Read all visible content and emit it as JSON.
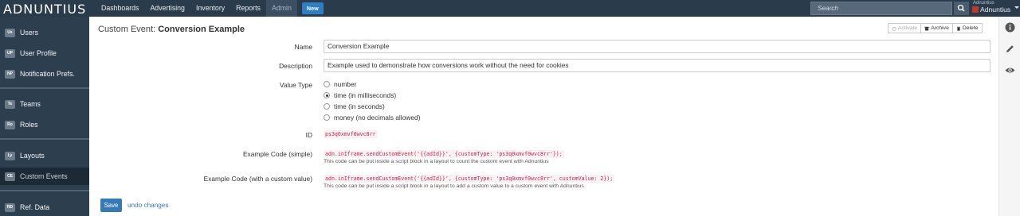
{
  "app": {
    "logo": "ADNUNTIUS"
  },
  "nav": {
    "items": [
      "Dashboards",
      "Advertising",
      "Inventory",
      "Reports",
      "Admin"
    ],
    "new_label": "New"
  },
  "search": {
    "placeholder": "Search"
  },
  "user": {
    "top": "Adnuntius",
    "name": "Adnuntius"
  },
  "sidebar": {
    "items": [
      {
        "badge": "Us",
        "label": "Users"
      },
      {
        "badge": "UP",
        "label": "User Profile"
      },
      {
        "badge": "NP",
        "label": "Notification Prefs."
      },
      {
        "badge": "Te",
        "label": "Teams"
      },
      {
        "badge": "Ro",
        "label": "Roles"
      },
      {
        "badge": "Ly",
        "label": "Layouts"
      },
      {
        "badge": "CE",
        "label": "Custom Events"
      },
      {
        "badge": "RD",
        "label": "Ref. Data"
      }
    ]
  },
  "page": {
    "title_prefix": "Custom Event:",
    "title_name": "Conversion Example",
    "actions": {
      "activate": "Activate",
      "archive": "Archive",
      "delete": "Delete"
    }
  },
  "form": {
    "name_label": "Name",
    "name_value": "Conversion Example",
    "description_label": "Description",
    "description_value": "Example used to demonstrate how conversions work without the need for cookies",
    "value_type_label": "Value Type",
    "value_type_options": [
      {
        "label": "number",
        "checked": false
      },
      {
        "label": "time (in milliseconds)",
        "checked": true
      },
      {
        "label": "time (in seconds)",
        "checked": false
      },
      {
        "label": "money (no decimals allowed)",
        "checked": false
      }
    ],
    "id_label": "ID",
    "id_value": "ps3q0xmvf0wvc8rr",
    "code_simple_label": "Example Code (simple)",
    "code_simple": "adn.inIframe.sendCustomEvent('{{adId}}', {customType: 'ps3q0xmvf0wvc8rr'});",
    "code_simple_help": "This code can be put inside a script block in a layout to count the custom event with Adnuntius",
    "code_custom_label": "Example Code (with a custom value)",
    "code_custom": "adn.inIframe.sendCustomEvent('{{adId}}', {customType: 'ps3q0xmvf0wvc8rr', customValue: 2});",
    "code_custom_help": "This code can be put inside a script block in a layout to add a custom value to a custom event with Adnuntius",
    "save_label": "Save",
    "undo_label": "undo changes"
  },
  "rail": {
    "icons": [
      "info-icon",
      "pencil-icon",
      "eye-icon"
    ]
  },
  "colors": {
    "topbar": "#2a3b4c",
    "sidebar": "#2d3e4f",
    "accent": "#337ab7",
    "code": "#c7254e"
  }
}
